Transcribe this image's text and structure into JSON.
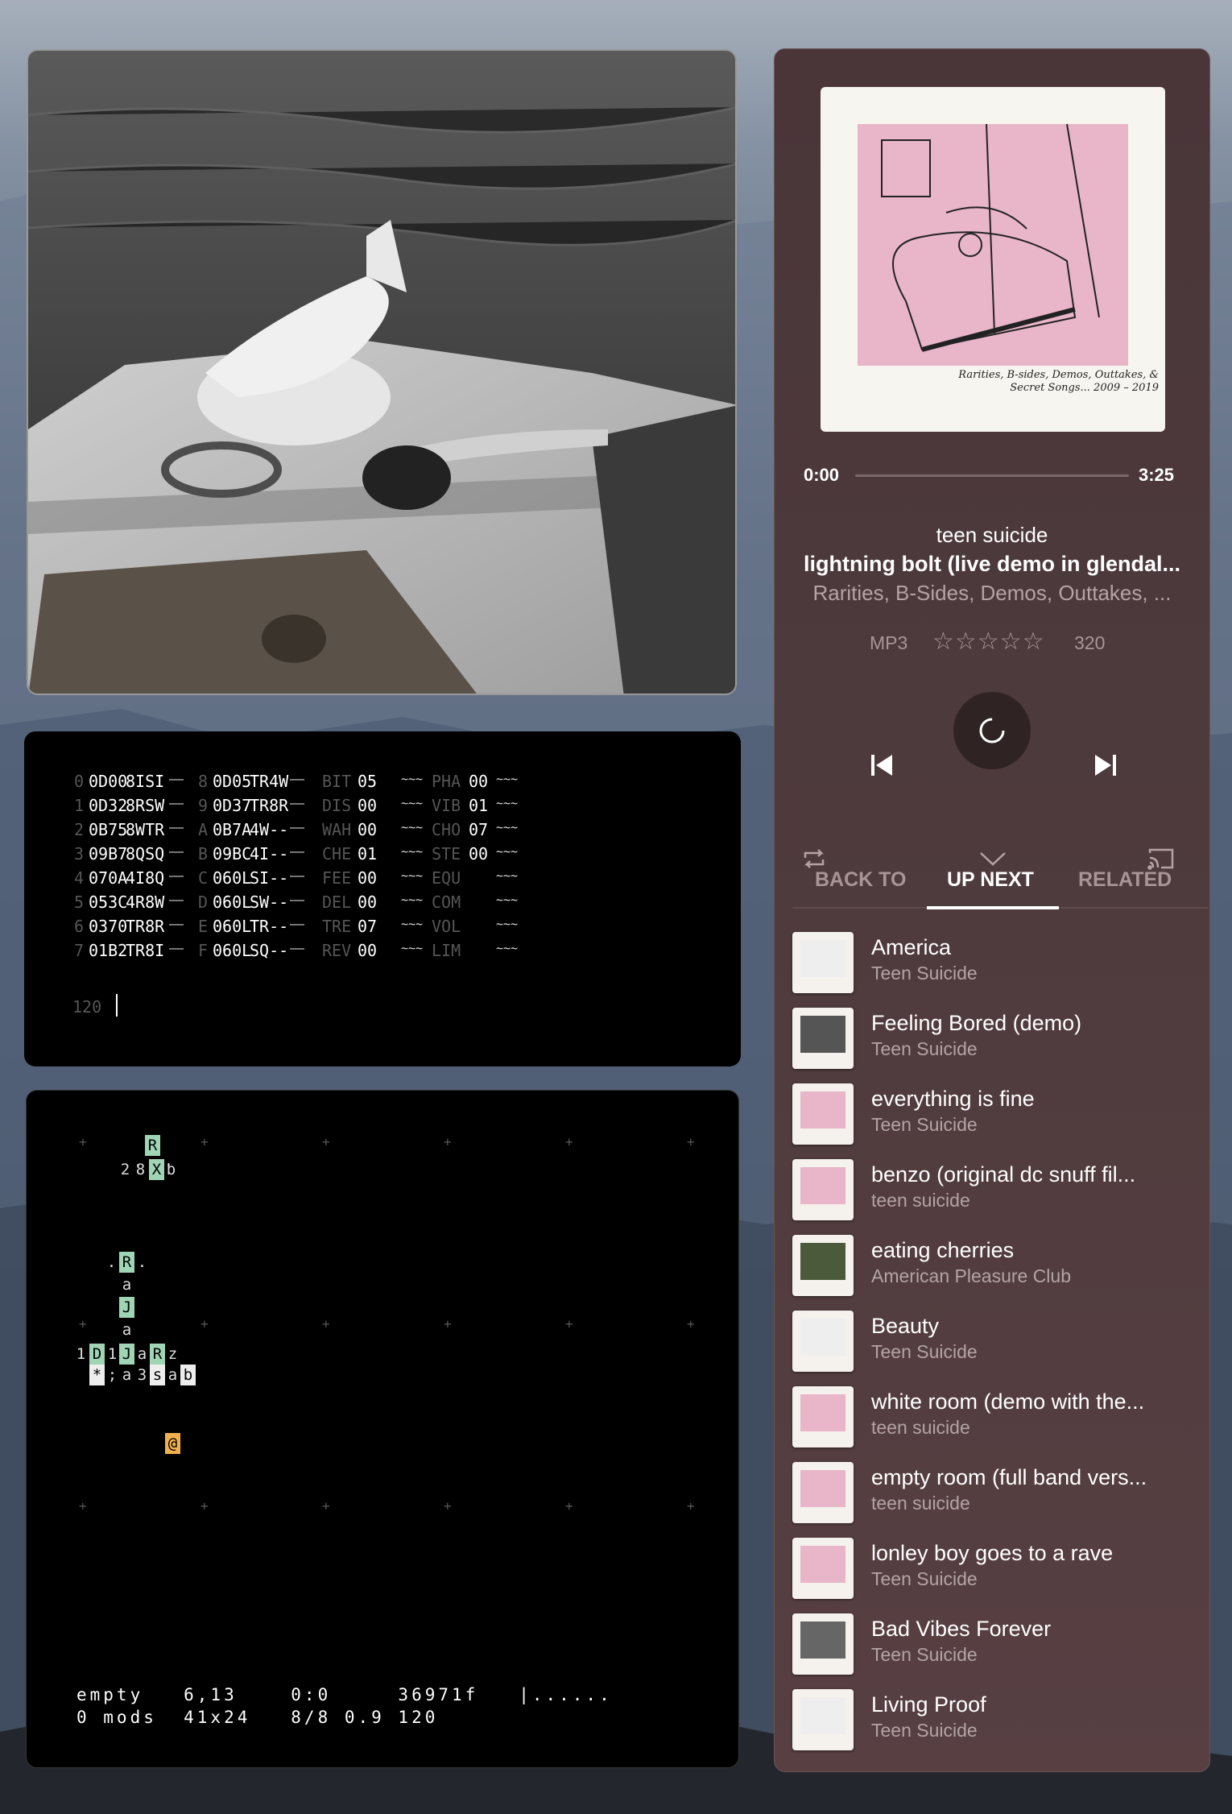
{
  "tracker": {
    "rows": [
      {
        "i": "0",
        "a": "0D00",
        "b": "8ISI",
        "j": "8",
        "c": "0D05",
        "d": "TR4W",
        "e": "BIT",
        "f": "05",
        "g": "PHA",
        "h": "00"
      },
      {
        "i": "1",
        "a": "0D32",
        "b": "8RSW",
        "j": "9",
        "c": "0D37",
        "d": "TR8R",
        "e": "DIS",
        "f": "00",
        "g": "VIB",
        "h": "01"
      },
      {
        "i": "2",
        "a": "0B75",
        "b": "8WTR",
        "j": "A",
        "c": "0B7A",
        "d": "4W--",
        "e": "WAH",
        "f": "00",
        "g": "CHO",
        "h": "07"
      },
      {
        "i": "3",
        "a": "09B7",
        "b": "8QSQ",
        "j": "B",
        "c": "09BC",
        "d": "4I--",
        "e": "CHE",
        "f": "01",
        "g": "STE",
        "h": "00"
      },
      {
        "i": "4",
        "a": "070A",
        "b": "4I8Q",
        "j": "C",
        "c": "060L",
        "d": "SI--",
        "e": "FEE",
        "f": "00",
        "g": "EQU",
        "h": ""
      },
      {
        "i": "5",
        "a": "053C",
        "b": "4R8W",
        "j": "D",
        "c": "060L",
        "d": "SW--",
        "e": "DEL",
        "f": "00",
        "g": "COM",
        "h": ""
      },
      {
        "i": "6",
        "a": "0370",
        "b": "TR8R",
        "j": "E",
        "c": "060L",
        "d": "TR--",
        "e": "TRE",
        "f": "07",
        "g": "VOL",
        "h": ""
      },
      {
        "i": "7",
        "a": "01B2",
        "b": "TR8I",
        "j": "F",
        "c": "060L",
        "d": "SQ--",
        "e": "REV",
        "f": "00",
        "g": "LIM",
        "h": ""
      }
    ],
    "bpm": "120"
  },
  "grid": {
    "status1": "empty   6,13    0:0     36971f   |......",
    "status2": "0 mods  41x24   8/8 0.9 120"
  },
  "player": {
    "time_elapsed": "0:00",
    "time_total": "3:25",
    "progress": 0.0,
    "artist": "teen suicide",
    "title": "lightning bolt (live demo in glendal...",
    "album": "Rarities, B-Sides, Demos, Outtakes, ...",
    "format": "MP3",
    "rating": 0,
    "stars": "☆☆☆☆☆",
    "bitrate": "320",
    "cover_caption": "Rarities, B-sides, Demos, Outtakes, & Secret Songs... 2009 – 2019",
    "tabs": [
      "BACK TO",
      "UP NEXT",
      "RELATED"
    ],
    "active_tab": "UP NEXT",
    "queue": [
      {
        "title": "America",
        "artist": "Teen Suicide"
      },
      {
        "title": "Feeling Bored (demo)",
        "artist": "Teen Suicide"
      },
      {
        "title": "everything is fine",
        "artist": "Teen Suicide"
      },
      {
        "title": "benzo (original dc snuff fil...",
        "artist": "teen suicide"
      },
      {
        "title": "eating cherries",
        "artist": "American Pleasure Club"
      },
      {
        "title": "Beauty",
        "artist": "Teen Suicide"
      },
      {
        "title": "white room (demo with the...",
        "artist": "teen suicide"
      },
      {
        "title": "empty room (full band vers...",
        "artist": "teen suicide"
      },
      {
        "title": "lonley boy goes to a rave",
        "artist": "Teen Suicide"
      },
      {
        "title": "Bad Vibes Forever",
        "artist": "Teen Suicide"
      },
      {
        "title": "Living Proof",
        "artist": "Teen Suicide"
      }
    ],
    "colors": {
      "panel": "#4d3a3c",
      "accent": "#ffffff",
      "muted": "#b3a3a5",
      "cover_pink": "#e8b6c8"
    }
  }
}
